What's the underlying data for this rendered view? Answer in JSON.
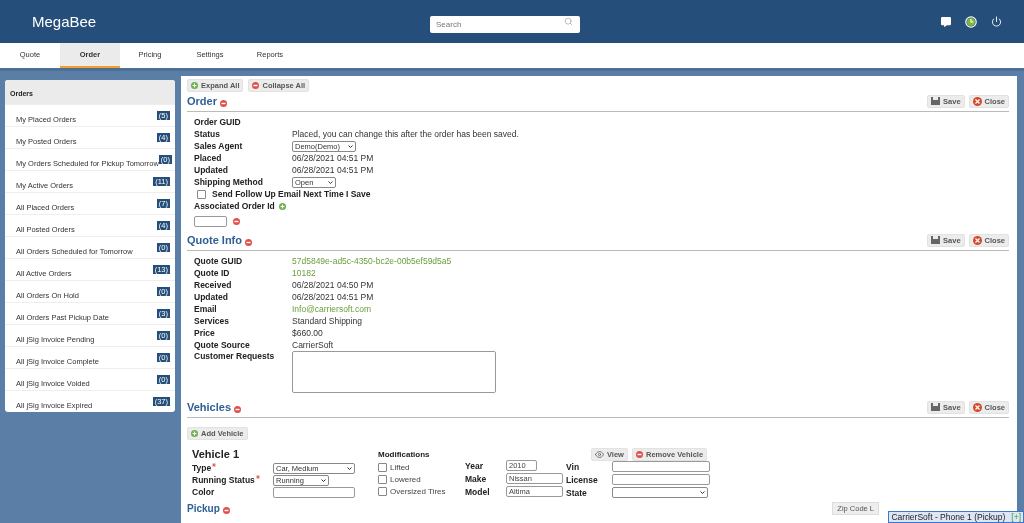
{
  "header": {
    "brand": "MegaBee",
    "search": {
      "placeholder": "Search"
    }
  },
  "tabs": [
    {
      "label": "Quote",
      "selected": false
    },
    {
      "label": "Order",
      "selected": true
    },
    {
      "label": "Pricing",
      "selected": false
    },
    {
      "label": "Settings",
      "selected": false
    },
    {
      "label": "Reports",
      "selected": false
    }
  ],
  "sidebar": {
    "title": "Orders",
    "items": [
      {
        "label": "My Placed Orders",
        "count": "(5)"
      },
      {
        "label": "My Posted Orders",
        "count": "(4)"
      },
      {
        "label": "My Orders Scheduled for Pickup Tomorrow",
        "count": "(0)"
      },
      {
        "label": "My Active Orders",
        "count": "(11)"
      },
      {
        "label": "All Placed Orders",
        "count": "(7)"
      },
      {
        "label": "All Posted Orders",
        "count": "(4)"
      },
      {
        "label": "All Orders Scheduled for Tomorrow",
        "count": "(0)"
      },
      {
        "label": "All Active Orders",
        "count": "(13)"
      },
      {
        "label": "All Orders On Hold",
        "count": "(0)"
      },
      {
        "label": "All Orders Past Pickup Date",
        "count": "(3)"
      },
      {
        "label": "All jSig Invoice Pending",
        "count": "(0)"
      },
      {
        "label": "All jSig Invoice Complete",
        "count": "(0)"
      },
      {
        "label": "All jSig Invoice Voided",
        "count": "(0)"
      },
      {
        "label": "All jSig Invoice Expired",
        "count": "(37)"
      }
    ]
  },
  "toolbar": {
    "expand": "Expand All",
    "collapse": "Collapse All"
  },
  "order": {
    "title": "Order",
    "save": "Save",
    "close": "Close",
    "rows": [
      {
        "kind": "text",
        "label": "Order GUID"
      },
      {
        "kind": "text",
        "label": "Status",
        "value": "Placed, you can change this after the order has been saved."
      },
      {
        "kind": "select",
        "label": "Sales Agent",
        "value": "Demo(Demo)"
      },
      {
        "kind": "text",
        "label": "Placed",
        "value": "06/28/2021 04:51 PM"
      },
      {
        "kind": "text",
        "label": "Updated",
        "value": "06/28/2021 04:51 PM"
      },
      {
        "kind": "select",
        "label": "Shipping Method",
        "value": "Open"
      },
      {
        "kind": "checkbox",
        "label": "Send Follow Up Email Next Time I Save",
        "checked": false
      },
      {
        "kind": "add",
        "label": "Associated Order Id"
      }
    ]
  },
  "quote": {
    "title": "Quote Info",
    "save": "Save",
    "close": "Close",
    "rows": [
      {
        "kind": "link",
        "label": "Quote GUID",
        "value": "57d5849e-ad5c-4350-bc2e-00b5ef59d5a5"
      },
      {
        "kind": "link",
        "label": "Quote ID",
        "value": "10182"
      },
      {
        "kind": "text",
        "label": "Received",
        "value": "06/28/2021 04:50 PM"
      },
      {
        "kind": "text",
        "label": "Updated",
        "value": "06/28/2021 04:51 PM"
      },
      {
        "kind": "link",
        "label": "Email",
        "value": "Info@carriersoft.com"
      },
      {
        "kind": "text",
        "label": "Services",
        "value": "Standard Shipping"
      },
      {
        "kind": "text",
        "label": "Price",
        "value": "$660.00"
      },
      {
        "kind": "text",
        "label": "Quote Source",
        "value": "CarrierSoft"
      },
      {
        "kind": "textarea",
        "label": "Customer Requests"
      }
    ]
  },
  "vehicles": {
    "title": "Vehicles",
    "save": "Save",
    "close": "Close",
    "add": "Add Vehicle",
    "vehicle": {
      "title": "Vehicle 1",
      "view": "View",
      "remove": "Remove Vehicle",
      "fields": [
        {
          "label": "Type",
          "required": true,
          "kind": "select",
          "value": "Car, Medium"
        },
        {
          "label": "Running Status",
          "required": true,
          "kind": "select",
          "value": "Running"
        },
        {
          "label": "Color",
          "required": false,
          "kind": "input"
        }
      ],
      "modifications": {
        "title": "Modifications",
        "options": [
          {
            "label": "Lifted",
            "checked": false
          },
          {
            "label": "Lowered",
            "checked": false
          },
          {
            "label": "Oversized Tires",
            "checked": false
          }
        ]
      },
      "specs": [
        {
          "label": "Year",
          "value": "2010"
        },
        {
          "label": "Make",
          "value": "Nissan"
        },
        {
          "label": "Model",
          "value": "Altima"
        }
      ],
      "ids": [
        {
          "label": "Vin",
          "kind": "input"
        },
        {
          "label": "License",
          "kind": "input"
        },
        {
          "label": "State",
          "kind": "select"
        }
      ]
    }
  },
  "pickup": {
    "title": "Pickup",
    "zip": "Zip Code L"
  },
  "phone_widget": {
    "label": "CarrierSoft - Phone 1 (Pickup)",
    "add": "[+]"
  }
}
